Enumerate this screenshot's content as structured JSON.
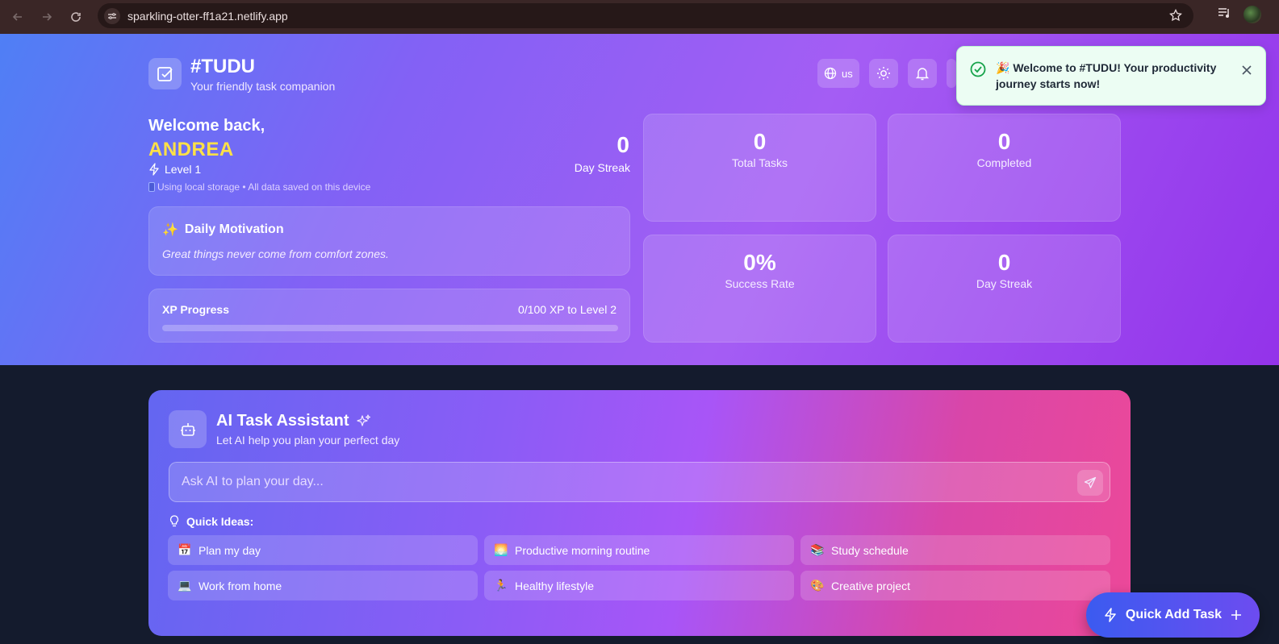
{
  "browser": {
    "url": "sparkling-otter-ff1a21.netlify.app"
  },
  "app": {
    "title": "#TUDU",
    "subtitle": "Your friendly task companion",
    "language": "us"
  },
  "user": {
    "welcome": "Welcome back,",
    "name": "ANDREA",
    "level": "Level 1",
    "storage_note": "Using local storage • All data saved on this device",
    "streak_value": "0",
    "streak_label": "Day Streak"
  },
  "motivation": {
    "title": "Daily Motivation",
    "quote": "Great things never come from comfort zones."
  },
  "xp": {
    "label": "XP Progress",
    "progress_text": "0/100 XP to Level 2",
    "progress_fraction": 0
  },
  "stats": [
    {
      "value": "0",
      "label": "Total Tasks"
    },
    {
      "value": "0",
      "label": "Completed"
    },
    {
      "value": "0%",
      "label": "Success Rate"
    },
    {
      "value": "0",
      "label": "Day Streak"
    }
  ],
  "toast": {
    "message": "🎉 Welcome to #TUDU! Your productivity journey starts now!"
  },
  "ai": {
    "title": "AI Task Assistant",
    "subtitle": "Let AI help you plan your perfect day",
    "placeholder": "Ask AI to plan your day...",
    "quick_ideas_label": "Quick Ideas:",
    "chips": [
      {
        "emoji": "📅",
        "label": "Plan my day"
      },
      {
        "emoji": "🌅",
        "label": "Productive morning routine"
      },
      {
        "emoji": "📚",
        "label": "Study schedule"
      },
      {
        "emoji": "💻",
        "label": "Work from home"
      },
      {
        "emoji": "🏃",
        "label": "Healthy lifestyle"
      },
      {
        "emoji": "🎨",
        "label": "Creative project"
      }
    ]
  },
  "fab": {
    "label": "Quick Add Task"
  },
  "colors": {
    "accent_yellow": "#fde047",
    "toast_green": "#16a34a",
    "page_dark": "#141b2d"
  }
}
